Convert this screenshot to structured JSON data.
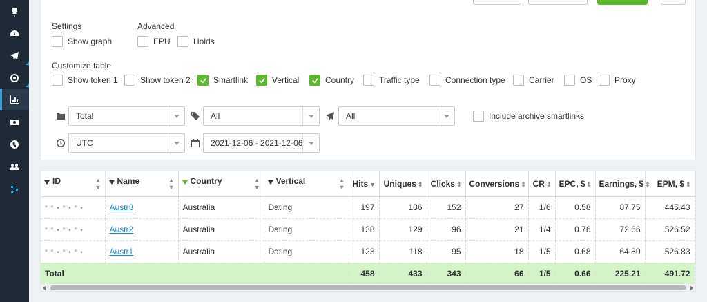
{
  "settings": {
    "title": "Settings",
    "show_graph": "Show graph",
    "advanced_title": "Advanced",
    "epu": "EPU",
    "holds": "Holds"
  },
  "customize": {
    "title": "Customize table",
    "options": [
      {
        "label": "Show token 1",
        "checked": false
      },
      {
        "label": "Show token 2",
        "checked": false
      },
      {
        "label": "Smartlink",
        "checked": true
      },
      {
        "label": "Vertical",
        "checked": true
      },
      {
        "label": "Country",
        "checked": true
      },
      {
        "label": "Traffic type",
        "checked": false
      },
      {
        "label": "Connection type",
        "checked": false
      },
      {
        "label": "Carrier",
        "checked": false
      },
      {
        "label": "OS",
        "checked": false
      },
      {
        "label": "Proxy",
        "checked": false
      }
    ]
  },
  "filters": {
    "group_by": "Total",
    "tags": "All",
    "smartlinks": "All",
    "include_archive": "Include archive smartlinks",
    "timezone": "UTC",
    "date_range": "2021-12-06 - 2021-12-06"
  },
  "table": {
    "headers": [
      "ID",
      "Name",
      "Country",
      "Vertical",
      "Hits",
      "Uniques",
      "Clicks",
      "Conversions",
      "CR",
      "EPC, $",
      "Earnings, $",
      "EPM, $"
    ],
    "rows": [
      {
        "id": "* * • * • * •",
        "name": "Austr3",
        "country": "Australia",
        "vertical": "Dating",
        "hits": "197",
        "uniques": "186",
        "clicks": "152",
        "conversions": "27",
        "cr": "1/6",
        "epc": "0.58",
        "earnings": "87.75",
        "epm": "445.43"
      },
      {
        "id": "* * • * • * •",
        "name": "Austr2",
        "country": "Australia",
        "vertical": "Dating",
        "hits": "138",
        "uniques": "129",
        "clicks": "96",
        "conversions": "21",
        "cr": "1/4",
        "epc": "0.76",
        "earnings": "72.66",
        "epm": "526.52"
      },
      {
        "id": "* * • * • * •",
        "name": "Austr1",
        "country": "Australia",
        "vertical": "Dating",
        "hits": "123",
        "uniques": "118",
        "clicks": "95",
        "conversions": "18",
        "cr": "1/5",
        "epc": "0.68",
        "earnings": "64.80",
        "epm": "526.83"
      }
    ],
    "total": {
      "label": "Total",
      "hits": "458",
      "uniques": "433",
      "clicks": "343",
      "conversions": "66",
      "cr": "1/5",
      "epc": "0.66",
      "earnings": "225.21",
      "epm": "491.72"
    }
  },
  "colors": {
    "accent": "#5cb82b",
    "sidebar": "#1f2a36",
    "link": "#1a8fc8",
    "total_row": "#d4f4c8"
  },
  "icons": [
    "lightbulb-icon",
    "dashboard-icon",
    "send-icon",
    "target-icon",
    "bar-chart-icon",
    "money-icon",
    "globe-icon",
    "users-icon",
    "sitemap-icon",
    "folder-icon",
    "tags-icon",
    "paper-plane-icon",
    "clock-icon",
    "calendar-icon"
  ]
}
